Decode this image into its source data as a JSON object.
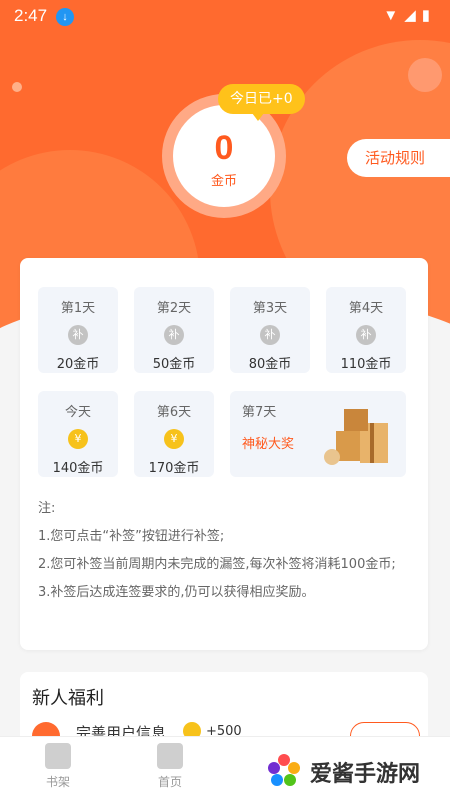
{
  "status_bar": {
    "time": "2:47"
  },
  "header": {
    "today_badge": "今日已+0",
    "coins_value": "0",
    "coins_unit": "金币",
    "rules_button": "活动规则"
  },
  "checkin": {
    "days": [
      {
        "label": "第1天",
        "reward": "20金币",
        "icon": "补"
      },
      {
        "label": "第2天",
        "reward": "50金币",
        "icon": "补"
      },
      {
        "label": "第3天",
        "reward": "80金币",
        "icon": "补"
      },
      {
        "label": "第4天",
        "reward": "110金币",
        "icon": "补"
      },
      {
        "label": "今天",
        "reward": "140金币",
        "icon": "¥"
      },
      {
        "label": "第6天",
        "reward": "170金币",
        "icon": "¥"
      }
    ],
    "day7": {
      "label": "第7天",
      "prize": "神秘大奖"
    }
  },
  "notes": {
    "title": "注:",
    "line1": "1.您可点击“补签”按钮进行补签;",
    "line2": "2.您可补签当前周期内未完成的漏签,每次补签将消耗100金币;",
    "line3": "3.补签后达成连签要求的,仍可以获得相应奖励。"
  },
  "welfare": {
    "title": "新人福利",
    "task_name": "完善用户信息",
    "task_reward": "+500"
  },
  "nav": {
    "bookshelf": "书架",
    "home": "首页"
  },
  "watermark": {
    "text": "爱酱手游网"
  },
  "colors": {
    "accent": "#ff6a2f",
    "gold": "#f7c21b"
  }
}
